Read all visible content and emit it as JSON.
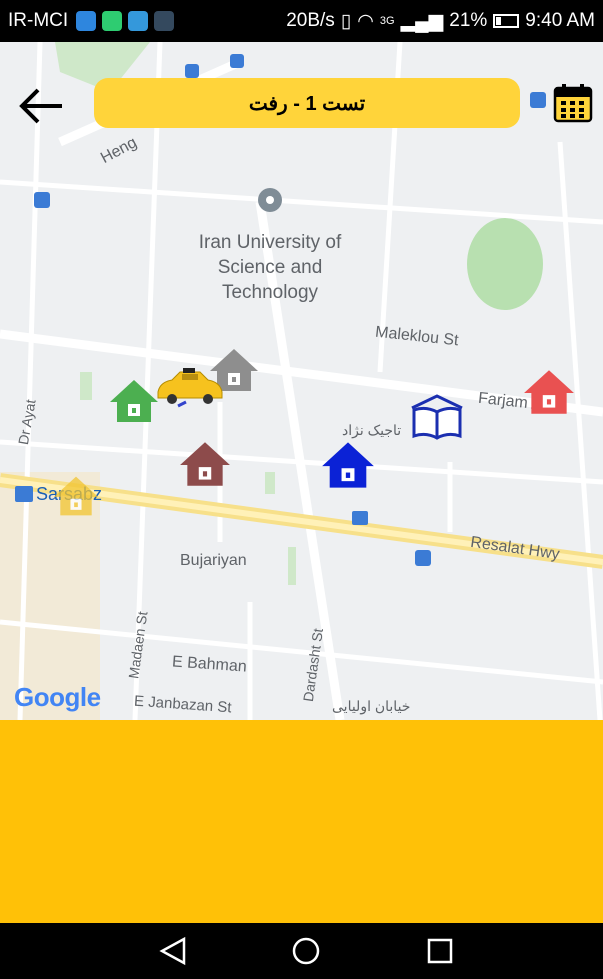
{
  "status_bar": {
    "carrier": "IR-MCI",
    "speed": "20B/s",
    "network": "3G",
    "battery": "21%",
    "time": "9:40 AM"
  },
  "header": {
    "title": "تست 1 - رفت",
    "back_icon": "arrow-left-icon",
    "calendar_icon": "calendar-icon"
  },
  "map": {
    "campus_name": "Iran University of Science and Technology",
    "streets": {
      "heng": "Heng",
      "maleklou": "Maleklou St",
      "farjam": "Farjam Ave",
      "dr_ayat": "Dr Ayat",
      "tajik_nejad": "تاجیک نژاد",
      "sarsabz": "Sarsabz",
      "resalat": "Resalat Hwy",
      "bujariyan": "Bujariyan",
      "madaen": "Madaen St",
      "dardasht": "Dardasht St",
      "e_bahman": "E Bahman",
      "e_janbazan": "E Janbazan St",
      "olia": "خیابان اولیایی"
    },
    "attribution": "Google"
  },
  "markers": [
    {
      "name": "home-marker-gray",
      "color": "#8e8e8e"
    },
    {
      "name": "home-marker-green",
      "color": "#4caf50"
    },
    {
      "name": "home-marker-brown",
      "color": "#8d4b4b"
    },
    {
      "name": "home-marker-blue",
      "color": "#0b22d6"
    },
    {
      "name": "home-marker-red",
      "color": "#e95151"
    },
    {
      "name": "home-marker-yellow",
      "color": "#f2c531"
    },
    {
      "name": "school-marker",
      "color": "#1b2fb0"
    },
    {
      "name": "taxi-marker",
      "color": "#f6c21e"
    }
  ],
  "colors": {
    "accent": "#ffd43a",
    "panel": "#ffc107"
  }
}
